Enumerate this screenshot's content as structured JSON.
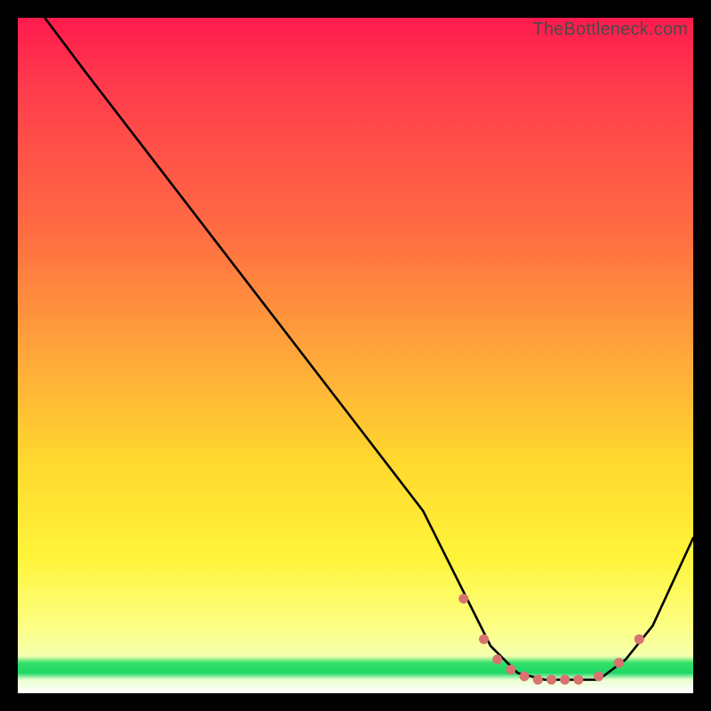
{
  "watermark": "TheBottleneck.com",
  "chart_data": {
    "type": "line",
    "title": "",
    "xlabel": "",
    "ylabel": "",
    "xlim": [
      0,
      100
    ],
    "ylim": [
      0,
      100
    ],
    "series": [
      {
        "name": "bottleneck-curve",
        "x": [
          4,
          10,
          20,
          30,
          40,
          50,
          60,
          66,
          70,
          74,
          78,
          82,
          86,
          90,
          94,
          100
        ],
        "y": [
          100,
          92,
          79,
          66,
          53,
          40,
          27,
          15,
          7,
          3,
          2,
          2,
          2,
          5,
          10,
          23
        ]
      }
    ],
    "markers": {
      "name": "valley-dots",
      "color": "#d8736f",
      "x": [
        66,
        69,
        71,
        73,
        75,
        77,
        79,
        81,
        83,
        86,
        89,
        92
      ],
      "y": [
        14,
        8,
        5,
        3.5,
        2.5,
        2,
        2,
        2,
        2,
        2.5,
        4.5,
        8
      ]
    }
  },
  "colors": {
    "curve": "#000000",
    "dots": "#d8736f",
    "frame": "#000000"
  }
}
